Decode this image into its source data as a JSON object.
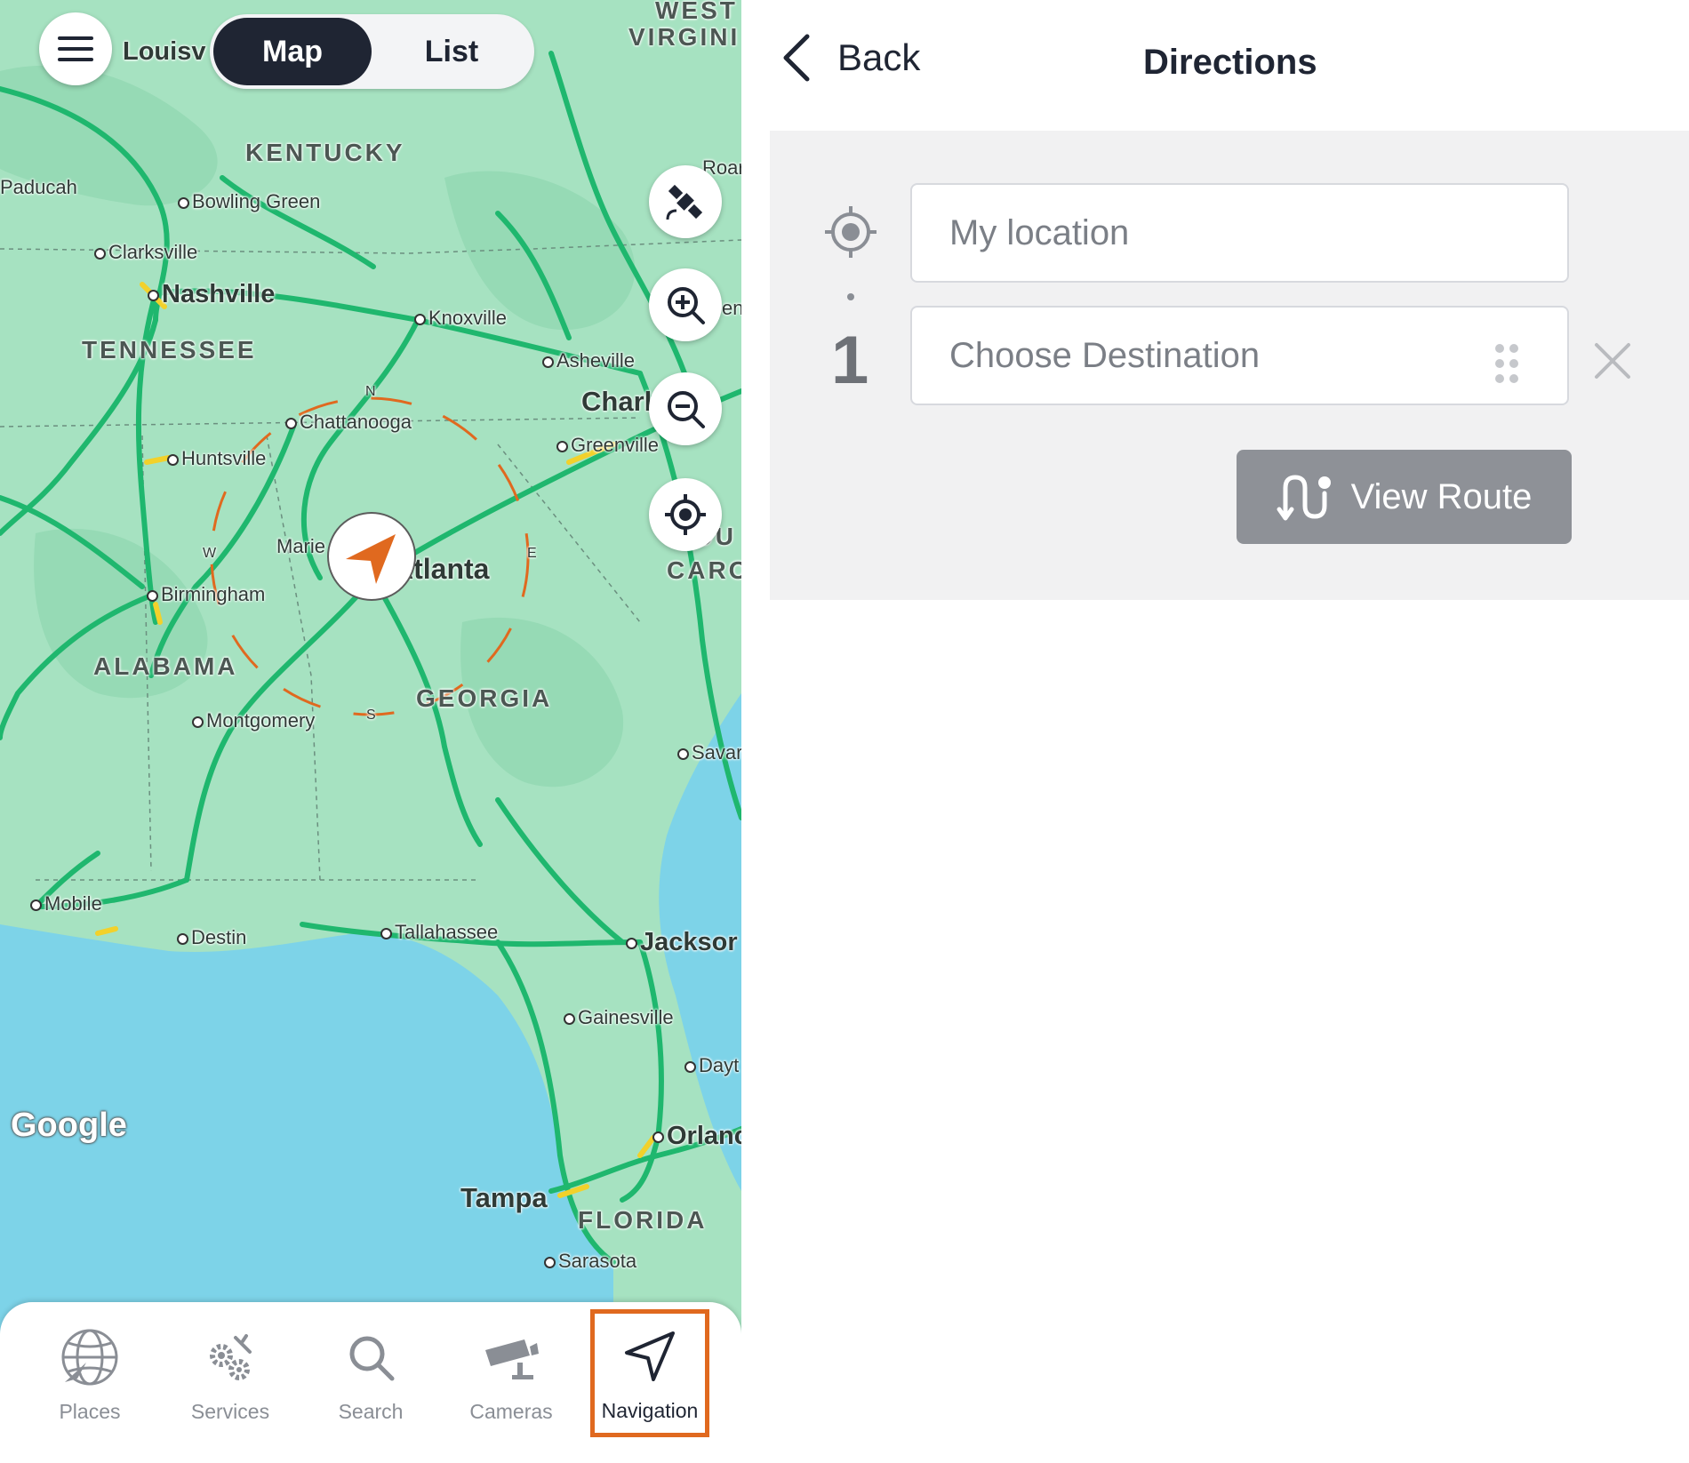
{
  "map": {
    "toggle": {
      "map_label": "Map",
      "list_label": "List"
    },
    "state_labels": {
      "kentucky": "KENTUCKY",
      "tennessee": "TENNESSEE",
      "alabama": "ALABAMA",
      "georgia": "GEORGIA",
      "florida": "FLORIDA",
      "west": "WEST",
      "virginia": "VIRGINI",
      "carolina_1": "OU",
      "carolina_2": "CARO"
    },
    "cities": {
      "louisv": "Louisv",
      "paducah": "Paducah",
      "bowling_green": "Bowling Green",
      "clarksville": "Clarksville",
      "nashville": "Nashville",
      "knoxville": "Knoxville",
      "asheville": "Asheville",
      "charl": "Charl",
      "chattanooga": "Chattanooga",
      "greenville": "Greenville",
      "huntsville": "Huntsville",
      "marie": "Marie",
      "atlanta": "Atlanta",
      "birmingham": "Birmingham",
      "montgomery": "Montgomery",
      "savan": "Savar",
      "mobile": "Mobile",
      "destin": "Destin",
      "tallahassee": "Tallahassee",
      "jackson": "Jacksor",
      "gainesville": "Gainesville",
      "dayt": "Dayt",
      "orlando": "Orlanc",
      "tampa": "Tampa",
      "sarasota": "Sarasota",
      "roa": "Roar",
      "en": "en"
    },
    "compass": {
      "n": "N",
      "e": "E",
      "s": "S",
      "w": "W"
    },
    "attribution": "Google",
    "colors": {
      "land": "#a6e2c1",
      "water": "#7dd3e8",
      "road": "#1fb76e",
      "accent": "#e0691f"
    }
  },
  "tabbar": {
    "items": [
      {
        "label": "Places",
        "icon": "globe-icon"
      },
      {
        "label": "Services",
        "icon": "gears-icon"
      },
      {
        "label": "Search",
        "icon": "search-icon"
      },
      {
        "label": "Cameras",
        "icon": "camera-icon"
      },
      {
        "label": "Navigation",
        "icon": "navigation-arrow-icon"
      }
    ],
    "active": "Navigation"
  },
  "directions": {
    "back_label": "Back",
    "title": "Directions",
    "origin_placeholder": "My location",
    "destination_placeholder": "Choose Destination",
    "stop_number": "1",
    "view_route_label": "View Route"
  }
}
